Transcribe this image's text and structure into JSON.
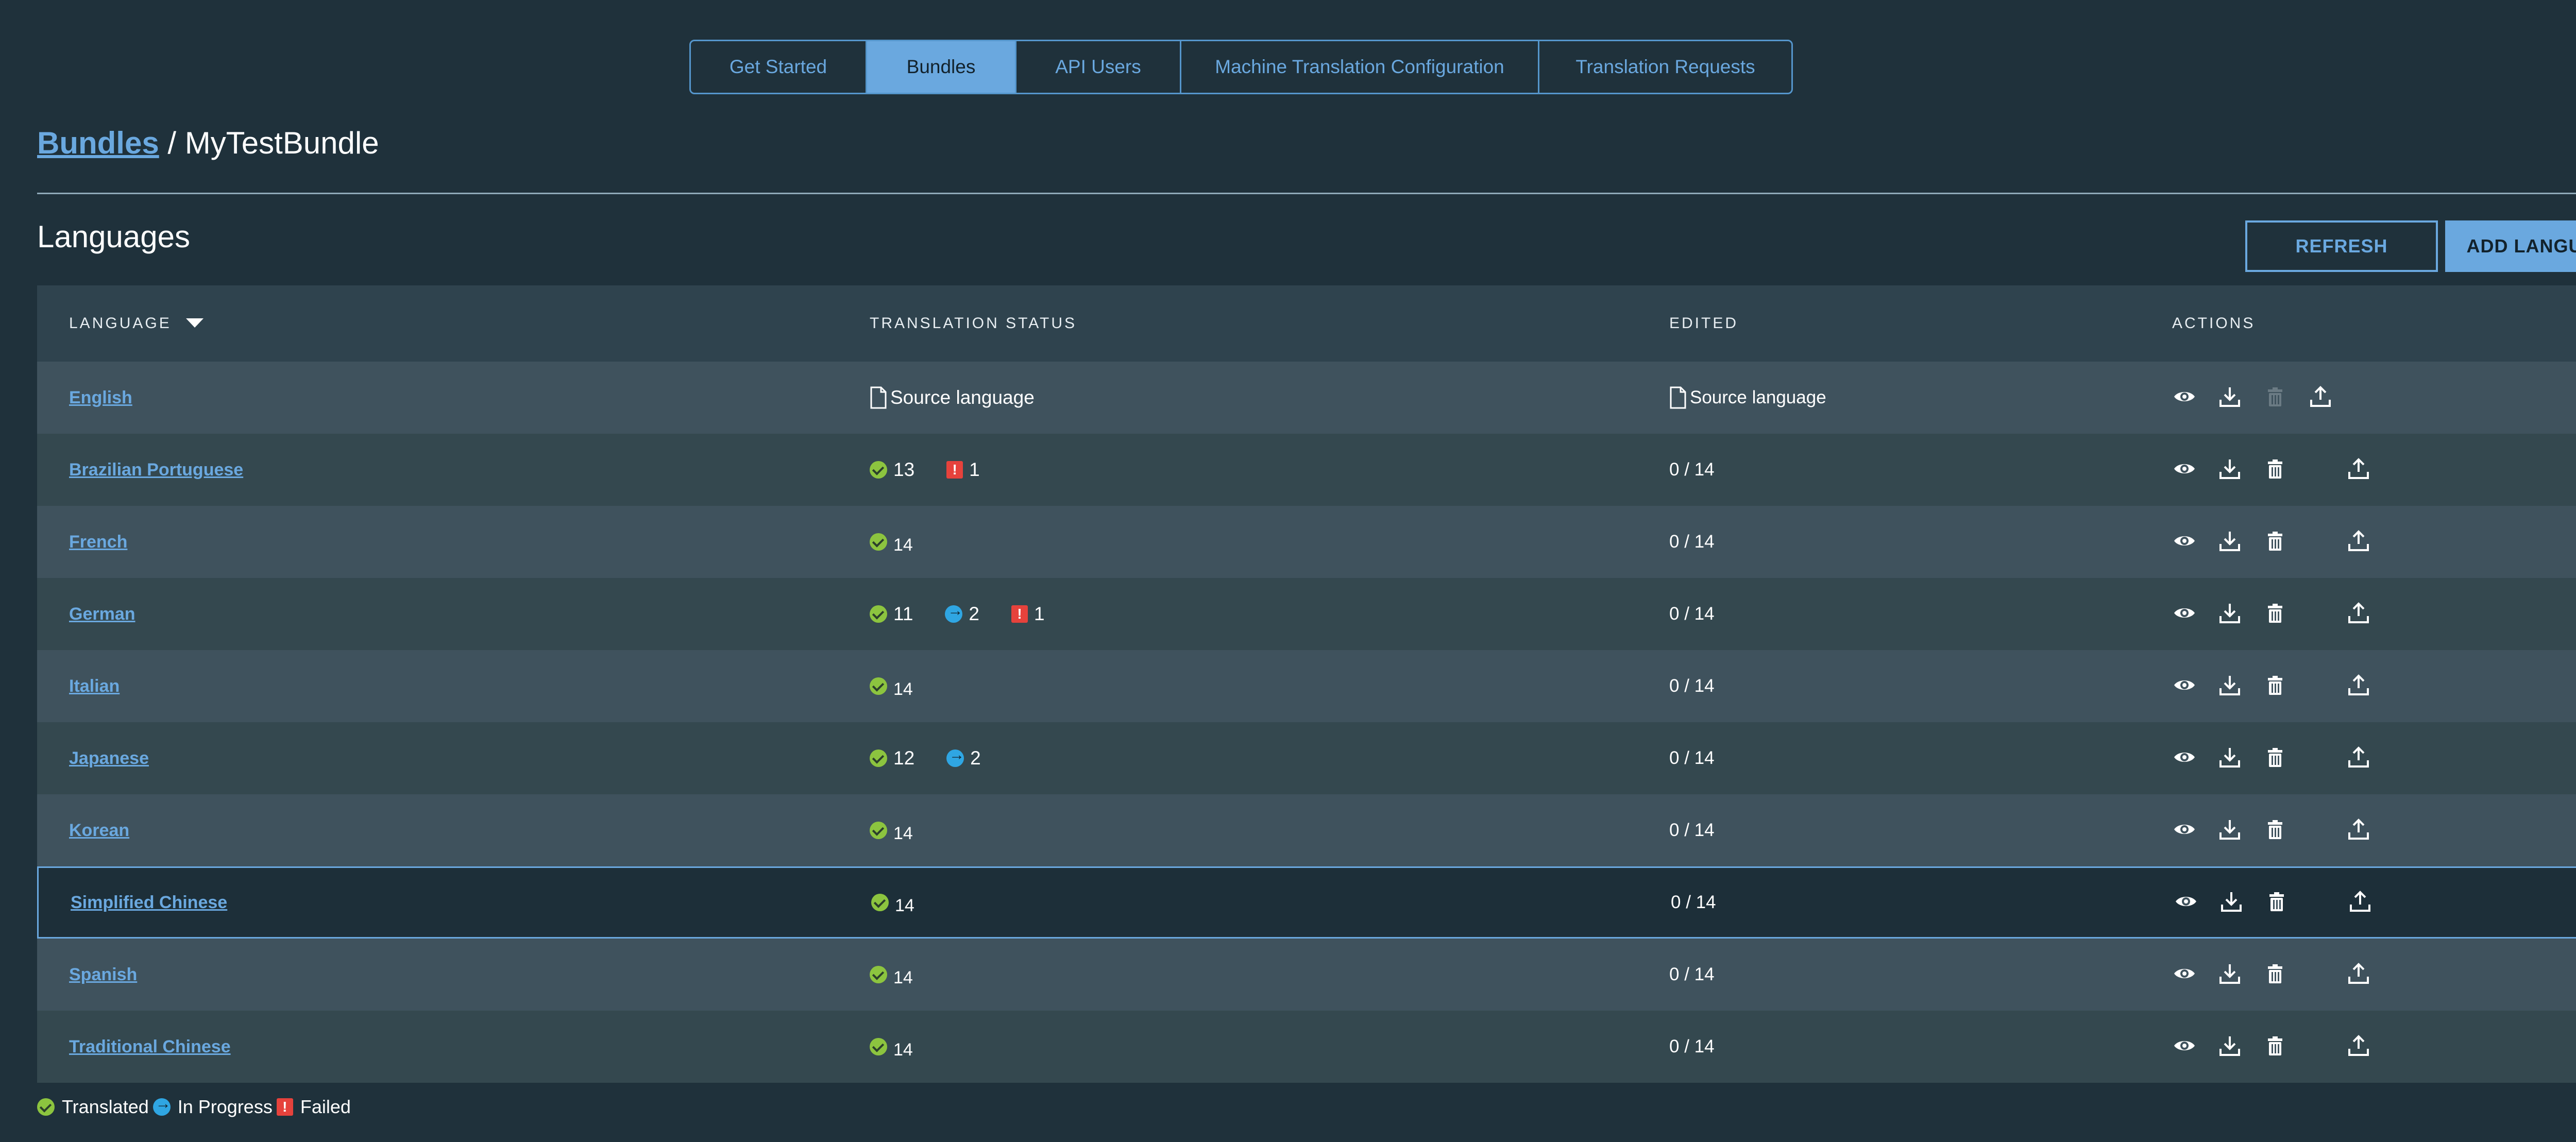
{
  "tabs": [
    {
      "label": "Get Started",
      "active": false
    },
    {
      "label": "Bundles",
      "active": true
    },
    {
      "label": "API Users",
      "active": false
    },
    {
      "label": "Machine Translation Configuration",
      "active": false
    },
    {
      "label": "Translation Requests",
      "active": false
    }
  ],
  "breadcrumb": {
    "root": "Bundles",
    "separator": "/",
    "current": "MyTestBundle"
  },
  "section": {
    "title": "Languages"
  },
  "buttons": {
    "refresh": "REFRESH",
    "add_language": "ADD LANGUAGE"
  },
  "table": {
    "headers": {
      "language": "LANGUAGE",
      "status": "TRANSLATION STATUS",
      "edited": "EDITED",
      "actions": "ACTIONS"
    },
    "rows": [
      {
        "language": "English",
        "source": true,
        "status_text": "Source language",
        "edited": "Source language"
      },
      {
        "language": "Brazilian Portuguese",
        "translated": "13",
        "failed": "1",
        "edited": "0 / 14"
      },
      {
        "language": "French",
        "translated": "14",
        "edited": "0 / 14"
      },
      {
        "language": "German",
        "translated": "11",
        "in_progress": "2",
        "failed": "1",
        "edited": "0 / 14"
      },
      {
        "language": "Italian",
        "translated": "14",
        "edited": "0 / 14"
      },
      {
        "language": "Japanese",
        "translated": "12",
        "in_progress": "2",
        "edited": "0 / 14"
      },
      {
        "language": "Korean",
        "translated": "14",
        "edited": "0 / 14"
      },
      {
        "language": "Simplified Chinese",
        "translated": "14",
        "edited": "0 / 14",
        "selected": true
      },
      {
        "language": "Spanish",
        "translated": "14",
        "edited": "0 / 14"
      },
      {
        "language": "Traditional Chinese",
        "translated": "14",
        "edited": "0 / 14"
      }
    ]
  },
  "legend": {
    "translated": "Translated",
    "in_progress": "In Progress",
    "failed": "Failed"
  },
  "colors": {
    "background": "#1f313b",
    "accent": "#6aa8df",
    "translated": "#8cc43f",
    "in_progress": "#2fa6e3",
    "failed": "#e6423c"
  }
}
